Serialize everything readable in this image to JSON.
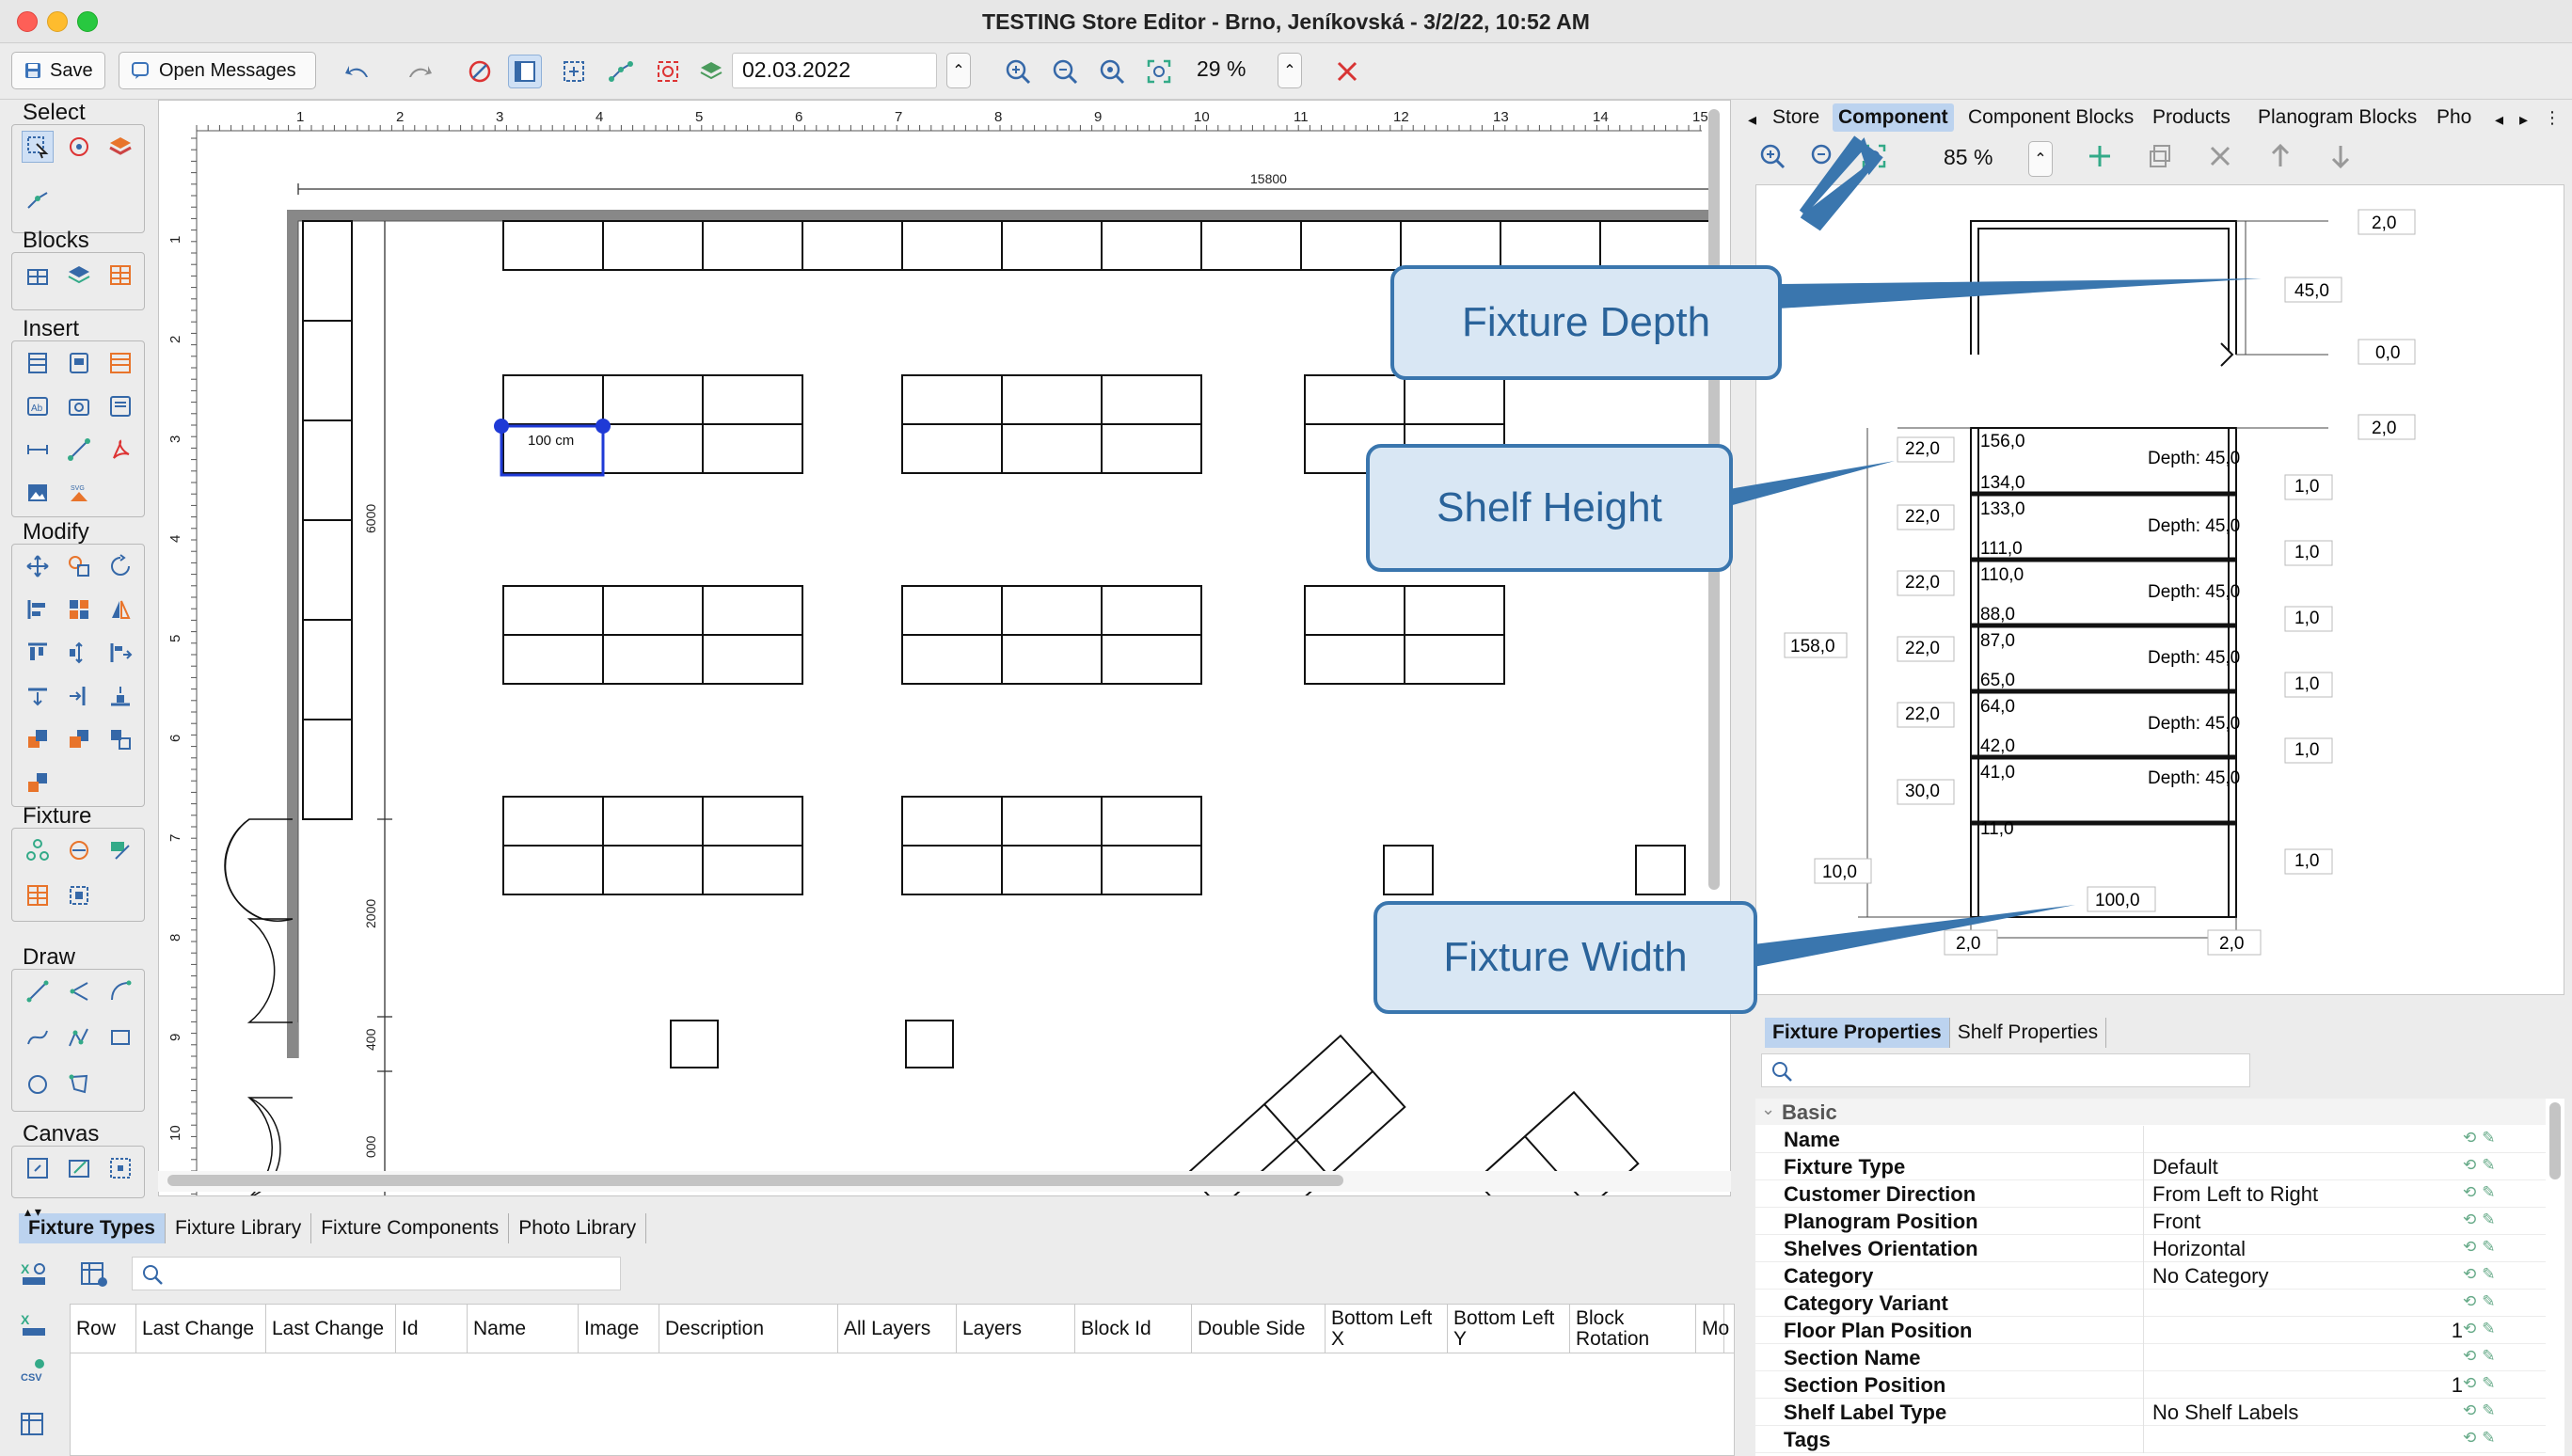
{
  "window": {
    "title": "TESTING Store Editor - Brno, Jeníkovská - 3/2/22, 10:52 AM"
  },
  "toolbar": {
    "save_label": "Save",
    "messages_label": "Open Messages",
    "date_value": "02.03.2022",
    "zoom_value": "29 %"
  },
  "palette": {
    "select": "Select",
    "blocks": "Blocks",
    "insert": "Insert",
    "modify": "Modify",
    "fixture": "Fixture",
    "draw": "Draw",
    "canvas": "Canvas"
  },
  "canvas": {
    "ruler_numbers": [
      "1",
      "2",
      "3",
      "4",
      "5",
      "6",
      "7",
      "8",
      "9",
      "10",
      "11",
      "12",
      "13",
      "14",
      "15"
    ],
    "vruler_numbers": [
      "1",
      "2",
      "3",
      "4",
      "5",
      "6",
      "7",
      "8",
      "9",
      "10"
    ],
    "dim_top": "15800",
    "dim_left_1": "6000",
    "dim_left_2": "2000",
    "dim_left_3": "400",
    "dim_left_4": "000",
    "selected_label": "100 cm"
  },
  "right_panel": {
    "tabs": [
      "Store",
      "Component",
      "Component Blocks",
      "Products",
      "Planogram Blocks",
      "Pho"
    ],
    "active_tab": "Component",
    "zoom_value": "85 %"
  },
  "preview": {
    "top_right": "2,0",
    "depth_value": "45,0",
    "zero_value": "0,0",
    "partial_label": "45,0",
    "top_right_2": "2,0",
    "total_height": "158,0",
    "bottom_left": "10,0",
    "width_value": "100,0",
    "bottom_2_left": "2,0",
    "bottom_2_right": "2,0",
    "shelves": [
      {
        "top": "156,0",
        "bottom": "134,0",
        "height": "22,0",
        "depth": "Depth: 45,0",
        "gap": "1,0"
      },
      {
        "top": "133,0",
        "bottom": "111,0",
        "height": "22,0",
        "depth": "Depth: 45,0",
        "gap": "1,0"
      },
      {
        "top": "110,0",
        "bottom": "88,0",
        "height": "22,0",
        "depth": "Depth: 45,0",
        "gap": "1,0"
      },
      {
        "top": "87,0",
        "bottom": "65,0",
        "height": "22,0",
        "depth": "Depth: 45,0",
        "gap": "1,0"
      },
      {
        "top": "64,0",
        "bottom": "42,0",
        "height": "22,0",
        "depth": "Depth: 45,0",
        "gap": "1,0"
      },
      {
        "top": "41,0",
        "bottom": "11,0",
        "height": "30,0",
        "depth": "Depth: 45,0",
        "gap": "1,0"
      }
    ]
  },
  "callouts": {
    "depth": "Fixture Depth",
    "shelf": "Shelf Height",
    "width": "Fixture Width"
  },
  "properties": {
    "tabs": [
      "Fixture Properties",
      "Shelf Properties"
    ],
    "group": "Basic",
    "rows": [
      {
        "name": "Name",
        "value": "",
        "num": ""
      },
      {
        "name": "Fixture Type",
        "value": "Default",
        "num": ""
      },
      {
        "name": "Customer Direction",
        "value": "From Left to Right",
        "num": ""
      },
      {
        "name": "Planogram Position",
        "value": "Front",
        "num": ""
      },
      {
        "name": "Shelves Orientation",
        "value": "Horizontal",
        "num": ""
      },
      {
        "name": "Category",
        "value": "No Category",
        "num": ""
      },
      {
        "name": "Category Variant",
        "value": "",
        "num": ""
      },
      {
        "name": "Floor Plan Position",
        "value": "",
        "num": "1"
      },
      {
        "name": "Section Name",
        "value": "",
        "num": ""
      },
      {
        "name": "Section Position",
        "value": "",
        "num": "1"
      },
      {
        "name": "Shelf Label Type",
        "value": "No Shelf Labels",
        "num": ""
      },
      {
        "name": "Tags",
        "value": "",
        "num": ""
      }
    ]
  },
  "bottom": {
    "tabs": [
      "Fixture Types",
      "Fixture Library",
      "Fixture Components",
      "Photo Library"
    ],
    "columns": [
      "Row",
      "Last Change",
      "Last Change",
      "Id",
      "Name",
      "Image",
      "Description",
      "All Layers",
      "Layers",
      "Block Id",
      "Double Side",
      "Bottom Left X",
      "Bottom Left Y",
      "Block Rotation",
      "Mo"
    ]
  },
  "colors": {
    "accent": "#3a76ae",
    "callout_fill": "#d9e7f4",
    "tab_active": "#bcd3ef",
    "selection": "#1f3ad6"
  }
}
